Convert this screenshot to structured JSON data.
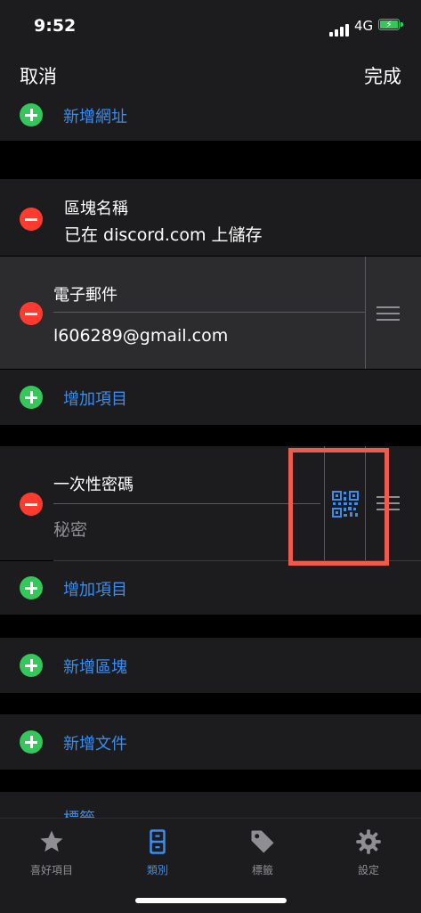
{
  "status": {
    "time": "9:52",
    "network": "4G"
  },
  "nav": {
    "cancel": "取消",
    "done": "完成"
  },
  "rows": {
    "add_url": "新增網址",
    "section_name_title": "區塊名稱",
    "section_name_value": "已在 discord.com 上儲存",
    "email_label": "電子郵件",
    "email_value": "l606289@gmail.com",
    "add_item_1": "增加項目",
    "otp_label": "一次性密碼",
    "otp_placeholder": "秘密",
    "add_item_2": "增加項目",
    "add_section": "新增區塊",
    "add_file": "新增文件",
    "tags_partial": "標籤"
  },
  "tabs": [
    {
      "label": "喜好項目",
      "icon": "star-icon"
    },
    {
      "label": "類別",
      "icon": "cabinet-icon"
    },
    {
      "label": "標籤",
      "icon": "tag-icon"
    },
    {
      "label": "設定",
      "icon": "gear-icon"
    }
  ],
  "colors": {
    "accent": "#3b8ced",
    "add": "#34c759",
    "remove": "#ff3b30",
    "highlight": "#ee5a4c"
  }
}
